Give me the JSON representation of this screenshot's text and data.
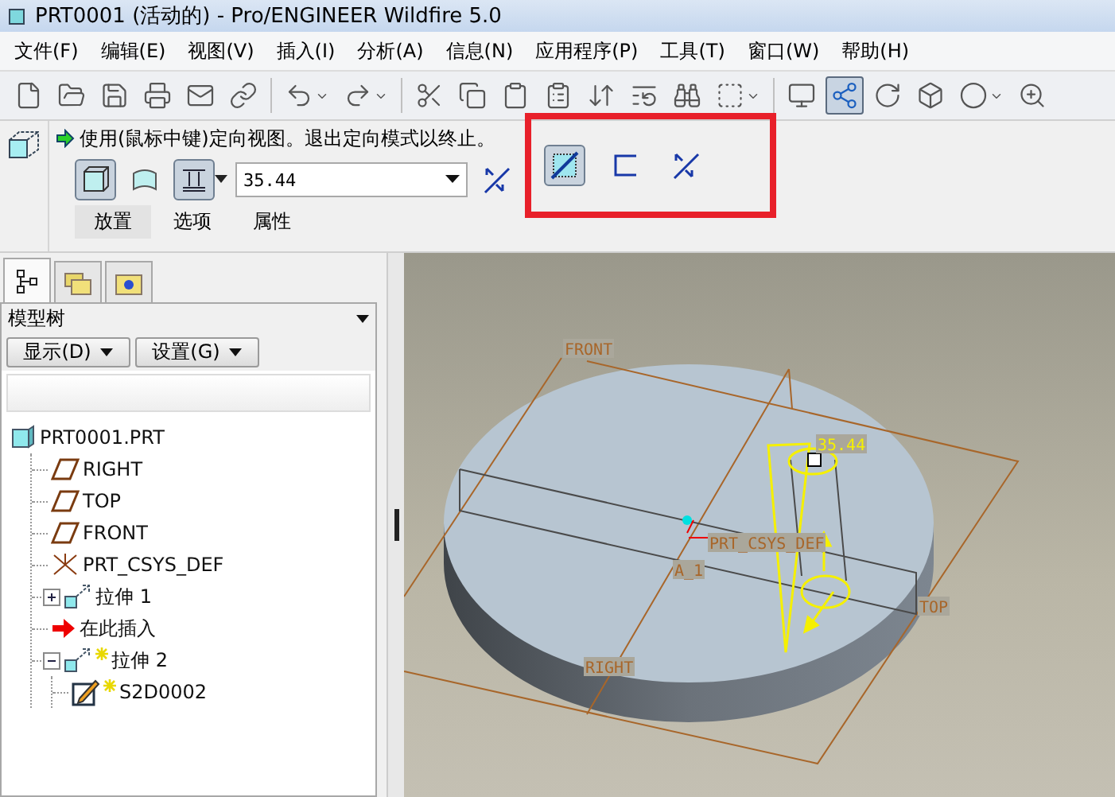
{
  "window": {
    "title": "PRT0001 (活动的) - Pro/ENGINEER Wildfire 5.0"
  },
  "menu": [
    "文件(F)",
    "编辑(E)",
    "视图(V)",
    "插入(I)",
    "分析(A)",
    "信息(N)",
    "应用程序(P)",
    "工具(T)",
    "窗口(W)",
    "帮助(H)"
  ],
  "toolbar": [
    [
      {
        "kind": "new",
        "selected": false
      },
      {
        "kind": "open",
        "selected": false
      },
      {
        "kind": "save",
        "selected": false
      },
      {
        "kind": "print",
        "selected": false
      },
      {
        "kind": "mail",
        "selected": false
      },
      {
        "kind": "link",
        "selected": false
      }
    ],
    [
      {
        "kind": "undo",
        "selected": false
      },
      {
        "kind": "redo",
        "selected": false
      }
    ],
    [
      {
        "kind": "cut",
        "selected": false
      },
      {
        "kind": "copy",
        "selected": false
      },
      {
        "kind": "paste",
        "selected": false
      },
      {
        "kind": "paste-special",
        "selected": false
      },
      {
        "kind": "regen",
        "selected": false
      },
      {
        "kind": "regen-manager",
        "selected": false
      },
      {
        "kind": "find",
        "selected": false
      },
      {
        "kind": "select-box",
        "selected": false
      }
    ],
    [
      {
        "kind": "repaint",
        "selected": false
      },
      {
        "kind": "spin-center",
        "selected": true
      },
      {
        "kind": "orient",
        "selected": false
      },
      {
        "kind": "view",
        "selected": false
      },
      {
        "kind": "shade",
        "selected": false
      },
      {
        "kind": "zoom",
        "selected": false
      }
    ]
  ],
  "dashboard": {
    "message": "使用(鼠标中键)定向视图。退出定向模式以终止。",
    "controls": [
      {
        "kind": "solid",
        "selected": true
      },
      {
        "kind": "surface",
        "selected": false
      },
      {
        "kind": "depth",
        "selected": true
      }
    ],
    "depth_value": "35.44",
    "flip": {
      "selected": false
    },
    "highlighted_controls": [
      {
        "kind": "remove",
        "selected": true
      },
      {
        "kind": "thicken",
        "selected": false
      },
      {
        "kind": "flip",
        "selected": false
      }
    ],
    "tabs": [
      {
        "label": "放置",
        "selected": true
      },
      {
        "label": "选项",
        "selected": false
      },
      {
        "label": "属性",
        "selected": false
      }
    ]
  },
  "navigator": {
    "tabs": [
      {
        "kind": "tree",
        "selected": true
      },
      {
        "kind": "folder",
        "selected": false
      },
      {
        "kind": "favorites",
        "selected": false
      }
    ],
    "title": "模型树",
    "buttons": [
      "显示(D)",
      "设置(G)"
    ],
    "tree": [
      {
        "label": "PRT0001.PRT",
        "kind": "part",
        "new": false,
        "children": [
          {
            "label": "RIGHT",
            "kind": "plane",
            "new": false
          },
          {
            "label": "TOP",
            "kind": "plane",
            "new": false
          },
          {
            "label": "FRONT",
            "kind": "plane",
            "new": false
          },
          {
            "label": "PRT_CSYS_DEF",
            "kind": "csys",
            "new": false
          },
          {
            "label": "拉伸 1",
            "kind": "extrude",
            "new": false,
            "expanded": false
          },
          {
            "label": "在此插入",
            "kind": "insert",
            "new": false
          },
          {
            "label": "拉伸 2",
            "kind": "extrude",
            "new": true,
            "expanded": true,
            "children": [
              {
                "label": "S2D0002",
                "kind": "sketch",
                "new": true
              }
            ]
          }
        ]
      }
    ]
  },
  "viewport": {
    "labels": [
      {
        "text": "FRONT",
        "kind": "plane"
      },
      {
        "text": "RIGHT",
        "kind": "plane"
      },
      {
        "text": "TOP",
        "kind": "plane"
      },
      {
        "text": "PRT_CSYS_DEF",
        "kind": "csys"
      },
      {
        "text": "A_1",
        "kind": "axis"
      },
      {
        "text": "35.44",
        "kind": "dimension"
      }
    ]
  }
}
